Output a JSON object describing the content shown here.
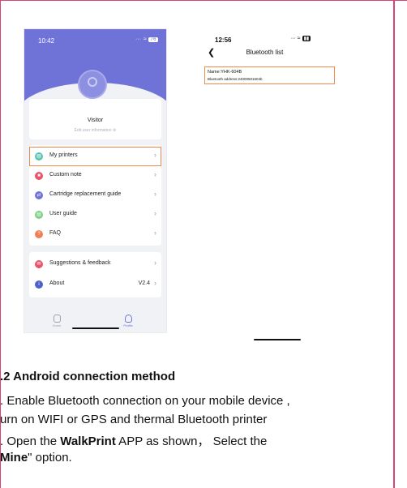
{
  "left_phone": {
    "time": "10:42",
    "signal": "∙∙∙ ≈",
    "battery": "76",
    "visitor": "Visitor",
    "edit_info": "Edit user information",
    "menu": [
      {
        "label": "My printers",
        "icon": "printer-icon",
        "color": "#5bc2b4"
      },
      {
        "label": "Custom note",
        "icon": "bookmark-icon",
        "color": "#e8546a"
      },
      {
        "label": "Cartridge replacement guide",
        "icon": "swap-icon",
        "color": "#6f73d8"
      },
      {
        "label": "User guide",
        "icon": "book-icon",
        "color": "#7ccf86"
      },
      {
        "label": "FAQ",
        "icon": "faq-icon",
        "color": "#f07e52"
      }
    ],
    "menu2": [
      {
        "label": "Suggestions & feedback",
        "icon": "feedback-icon",
        "color": "#e8546a"
      },
      {
        "label": "About",
        "icon": "info-icon",
        "color": "#4d62c7",
        "version": "V2.4"
      }
    ],
    "tab_home": "Home",
    "tab_profile": "Profile"
  },
  "right_phone": {
    "time": "12:56",
    "signal": "∙∙∙ ≈",
    "title": "Bluetooth list",
    "device_name": "Name:YHK-604B",
    "device_address": "Bluetooth address:24000501604b"
  },
  "text": {
    "heading": ".2 Android connection method",
    "line1": ". Enable Bluetooth connection on your mobile device ,",
    "line2": "urn on WIFI or GPS and thermal Bluetooth printer",
    "line3_pre": ". Open the ",
    "line3_app": "WalkPrint",
    "line3_post": " APP as shown， Select the",
    "line4_pre": "",
    "line4_bold": "Mine",
    "line4_post": "\" option."
  },
  "colors": {
    "accent": "#6f73d8",
    "highlight": "#f08a4b",
    "frame": "#d6457a"
  }
}
